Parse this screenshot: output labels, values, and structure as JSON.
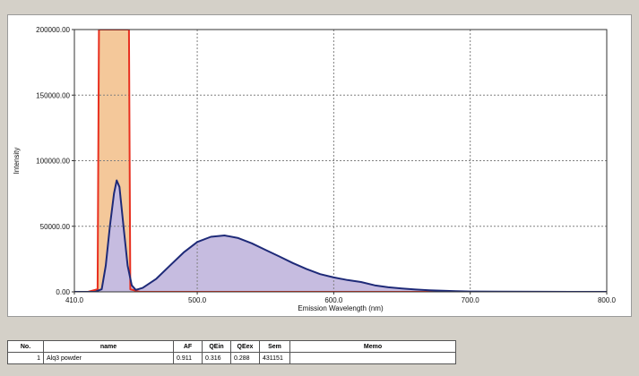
{
  "chart_data": {
    "type": "area",
    "xlabel": "Emission Wavelength (nm)",
    "ylabel": "Intensity",
    "xlim": [
      410.0,
      800.0
    ],
    "ylim": [
      0.0,
      200000.0
    ],
    "x_ticks": [
      "410.0",
      "500.0",
      "600.0",
      "700.0",
      "800.0"
    ],
    "y_ticks": [
      "0.00",
      "50000.00",
      "100000.00",
      "150000.00",
      "200000.00"
    ],
    "grid": true,
    "series": [
      {
        "color": "#e83020",
        "fill": "#f4c89a",
        "points": [
          [
            410,
            0
          ],
          [
            420,
            0
          ],
          [
            427,
            2000
          ],
          [
            428,
            200000
          ],
          [
            450,
            200000
          ],
          [
            451,
            2000
          ],
          [
            458,
            0
          ],
          [
            800,
            0
          ]
        ]
      },
      {
        "color": "#1e2a78",
        "fill": "#c6bce0",
        "points": [
          [
            410,
            0
          ],
          [
            425,
            0
          ],
          [
            430,
            2000
          ],
          [
            433,
            20000
          ],
          [
            436,
            50000
          ],
          [
            439,
            75000
          ],
          [
            441,
            85000
          ],
          [
            443,
            80000
          ],
          [
            446,
            50000
          ],
          [
            449,
            20000
          ],
          [
            452,
            5000
          ],
          [
            455,
            1500
          ],
          [
            460,
            3000
          ],
          [
            470,
            10000
          ],
          [
            480,
            20000
          ],
          [
            490,
            30000
          ],
          [
            500,
            38000
          ],
          [
            510,
            42000
          ],
          [
            520,
            43000
          ],
          [
            530,
            41000
          ],
          [
            540,
            37000
          ],
          [
            550,
            32000
          ],
          [
            560,
            27000
          ],
          [
            570,
            22000
          ],
          [
            580,
            17500
          ],
          [
            590,
            13500
          ],
          [
            600,
            11000
          ],
          [
            610,
            9000
          ],
          [
            620,
            7500
          ],
          [
            630,
            5000
          ],
          [
            640,
            3500
          ],
          [
            650,
            2500
          ],
          [
            660,
            1800
          ],
          [
            670,
            1200
          ],
          [
            680,
            800
          ],
          [
            690,
            500
          ],
          [
            700,
            300
          ],
          [
            720,
            150
          ],
          [
            750,
            50
          ],
          [
            800,
            0
          ]
        ]
      }
    ]
  },
  "table": {
    "columns": [
      "No.",
      "name",
      "AF",
      "QEin",
      "QEex",
      "Sem",
      "Memo"
    ],
    "rows": [
      [
        "1",
        "Alq3 powder",
        "0.911",
        "0.316",
        "0.288",
        "431151",
        ""
      ]
    ]
  }
}
